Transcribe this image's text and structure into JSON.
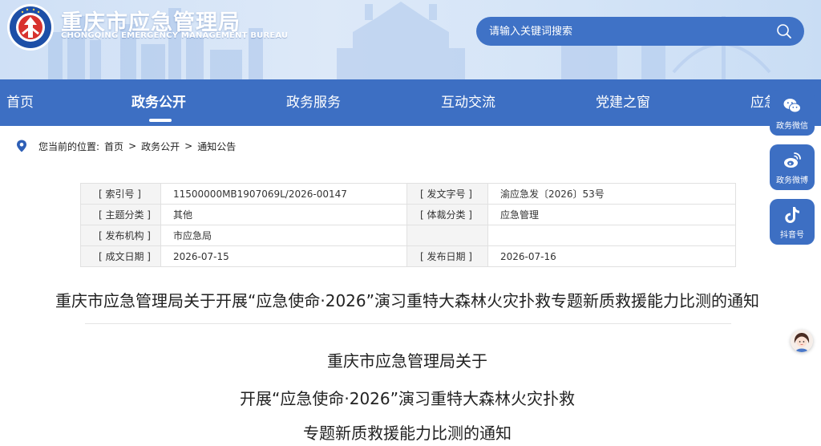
{
  "header": {
    "title": "重庆市应急管理局",
    "subtitle": "CHONGQING EMERGENCY MANAGEMENT BUREAU",
    "emblem_text": "中国应急管理",
    "brand_color": "#3d6fc3",
    "search_placeholder": "请输入关键词搜索"
  },
  "nav": {
    "items": [
      {
        "label": "首页"
      },
      {
        "label": "政务公开",
        "active": true
      },
      {
        "label": "政务服务"
      },
      {
        "label": "互动交流"
      },
      {
        "label": "党建之窗"
      },
      {
        "label": "应急"
      }
    ]
  },
  "breadcrumb": {
    "prefix": "您当前的位置:",
    "items": [
      "首页",
      "政务公开",
      "通知公告"
    ],
    "separator": ">"
  },
  "side_buttons": [
    {
      "label": "政务微信",
      "icon": "wechat-icon"
    },
    {
      "label": "政务微博",
      "icon": "weibo-icon"
    },
    {
      "label": "抖音号",
      "icon": "douyin-icon"
    }
  ],
  "info": {
    "index_label": "[ 索引号 ]",
    "index_value": "11500000MB1907069L/2026-00147",
    "doc_no_label": "[ 发文字号 ]",
    "doc_no_value": "渝应急发〔2026〕53号",
    "topic_label": "[ 主题分类 ]",
    "topic_value": "其他",
    "genre_label": "[ 体裁分类 ]",
    "genre_value": "应急管理",
    "publisher_label": "[ 发布机构 ]",
    "publisher_value": "市应急局",
    "created_label": "[ 成文日期 ]",
    "created_value": "2026-07-15",
    "published_label": "[ 发布日期 ]",
    "published_value": "2026-07-16"
  },
  "article": {
    "title": "重庆市应急管理局关于开展“应急使命·2026”演习重特大森林火灾扑救专题新质救援能力比测的通知",
    "heading_lines": [
      "重庆市应急管理局关于",
      "开展“应急使命·2026”演习重特大森林火灾扑救",
      "专题新质救援能力比测的通知"
    ]
  }
}
